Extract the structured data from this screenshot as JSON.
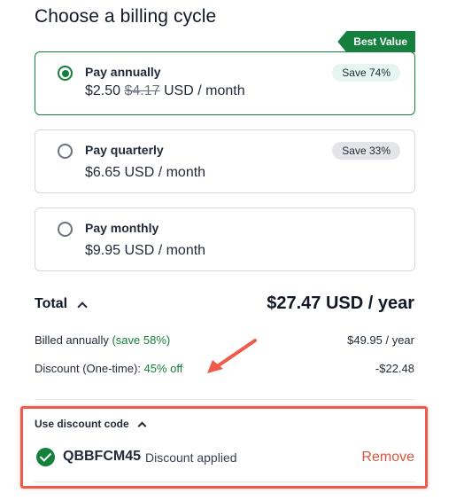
{
  "page": {
    "title": "Choose a billing cycle"
  },
  "plans": [
    {
      "name": "Pay annually",
      "price_current": "$2.50",
      "price_original": "$4.17",
      "price_suffix": "USD / month",
      "badge": "Save 74%",
      "ribbon": "Best Value",
      "selected": true
    },
    {
      "name": "Pay quarterly",
      "price": "$6.65 USD / month",
      "badge": "Save 33%",
      "selected": false
    },
    {
      "name": "Pay monthly",
      "price": "$9.95 USD / month",
      "selected": false
    }
  ],
  "summary": {
    "total_label": "Total",
    "total_amount": "$27.47 USD / year",
    "billed_label": "Billed annually",
    "billed_save": "(save 58%)",
    "billed_value": "$49.95 / year",
    "discount_label": "Discount (One-time):",
    "discount_off": "45% off",
    "discount_value": "-$22.48"
  },
  "discount_code": {
    "toggle_label": "Use discount code",
    "code": "QBBFCM45",
    "status": "Discount applied",
    "remove_label": "Remove"
  },
  "colors": {
    "accent_green": "#15803d",
    "annotation_red": "#ef5a4b",
    "remove_red": "#e2533f"
  },
  "icons": [
    "radio-selected-icon",
    "radio-empty-icon",
    "chevron-up-icon",
    "check-circle-icon",
    "arrow-annotation-icon"
  ]
}
